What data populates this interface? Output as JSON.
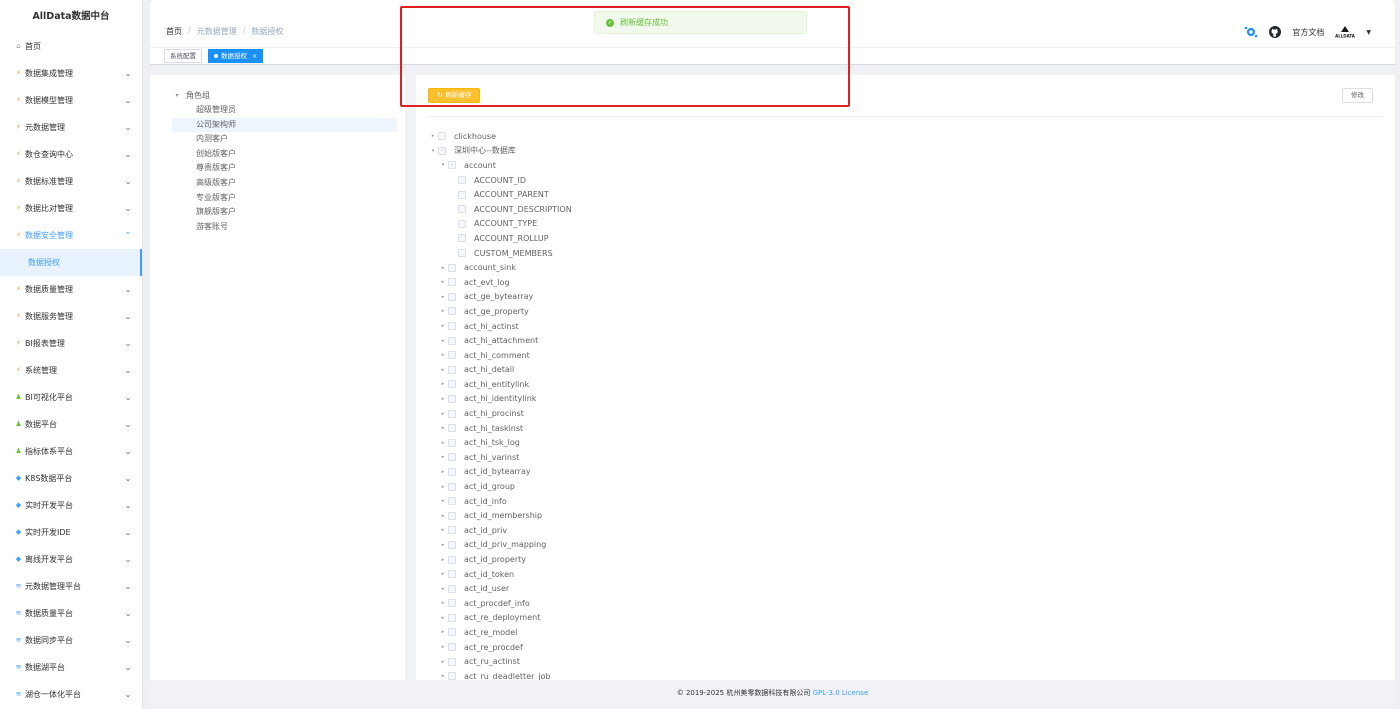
{
  "app": {
    "title": "AllData数据中台"
  },
  "sidebar": {
    "items": [
      {
        "label": "首页",
        "icon": "home-icon",
        "arrow": false
      },
      {
        "label": "数据集成管理",
        "icon": "lightning-icon",
        "arrow": true
      },
      {
        "label": "数据模型管理",
        "icon": "lightning-icon",
        "arrow": true
      },
      {
        "label": "元数据管理",
        "icon": "lightning-icon",
        "arrow": true
      },
      {
        "label": "数仓查询中心",
        "icon": "lightning-icon",
        "arrow": true
      },
      {
        "label": "数据标准管理",
        "icon": "lightning-icon",
        "arrow": true
      },
      {
        "label": "数据比对管理",
        "icon": "lightning-icon",
        "arrow": true
      },
      {
        "label": "数据安全管理",
        "icon": "lightning-icon",
        "arrow": true,
        "active": true
      },
      {
        "label": "数据质量管理",
        "icon": "lightning-icon",
        "arrow": true
      },
      {
        "label": "数据服务管理",
        "icon": "lightning-icon",
        "arrow": true
      },
      {
        "label": "BI报表管理",
        "icon": "lightning-icon",
        "arrow": true
      },
      {
        "label": "系统管理",
        "icon": "lightning-icon",
        "arrow": true
      },
      {
        "label": "BI可视化平台",
        "icon": "person-icon",
        "arrow": true
      },
      {
        "label": "数据平台",
        "icon": "person-icon",
        "arrow": true
      },
      {
        "label": "指标体系平台",
        "icon": "person-icon",
        "arrow": true
      },
      {
        "label": "K8S数据平台",
        "icon": "diamond-icon",
        "arrow": true
      },
      {
        "label": "实时开发平台",
        "icon": "diamond-icon",
        "arrow": true
      },
      {
        "label": "实时开发IDE",
        "icon": "diamond-icon",
        "arrow": true
      },
      {
        "label": "离线开发平台",
        "icon": "diamond-icon",
        "arrow": true
      },
      {
        "label": "元数据管理平台",
        "icon": "layers-icon",
        "arrow": true
      },
      {
        "label": "数据质量平台",
        "icon": "layers-icon",
        "arrow": true
      },
      {
        "label": "数据同步平台",
        "icon": "layers-icon",
        "arrow": true
      },
      {
        "label": "数据湖平台",
        "icon": "layers-icon",
        "arrow": true
      },
      {
        "label": "湖仓一体化平台",
        "icon": "layers-icon",
        "arrow": true
      }
    ],
    "active_sub": "数据授权"
  },
  "header": {
    "breadcrumb": [
      "首页",
      "元数据管理",
      "数据授权"
    ],
    "docs_label": "官方文档",
    "brand_label": "ALLDATA"
  },
  "tags": [
    {
      "label": "系统配置",
      "active": false
    },
    {
      "label": "数据授权",
      "active": true
    }
  ],
  "toast": {
    "message": "刷新缓存成功"
  },
  "left_tree": {
    "root": "角色组",
    "children": [
      "超级管理员",
      "公司架构师",
      "内测客户",
      "创始版客户",
      "尊贵版客户",
      "高级版客户",
      "专业版客户",
      "旗舰版客户",
      "游客账号"
    ],
    "selected_index": 1
  },
  "toolbar": {
    "refresh_label": "刷新缓存",
    "edit_label": "修改"
  },
  "right_tree": [
    {
      "label": "clickhouse",
      "level": 0,
      "caret": "▸"
    },
    {
      "label": "深圳中心--数据库",
      "level": 0,
      "caret": "▾",
      "partial": true
    },
    {
      "label": "account",
      "level": 1,
      "caret": "▾",
      "partial": true
    },
    {
      "label": "ACCOUNT_ID",
      "level": 2,
      "caret": ""
    },
    {
      "label": "ACCOUNT_PARENT",
      "level": 2,
      "caret": ""
    },
    {
      "label": "ACCOUNT_DESCRIPTION",
      "level": 2,
      "caret": ""
    },
    {
      "label": "ACCOUNT_TYPE",
      "level": 2,
      "caret": ""
    },
    {
      "label": "ACCOUNT_ROLLUP",
      "level": 2,
      "caret": ""
    },
    {
      "label": "CUSTOM_MEMBERS",
      "level": 2,
      "caret": ""
    },
    {
      "label": "account_sink",
      "level": 1,
      "caret": "▸"
    },
    {
      "label": "act_evt_log",
      "level": 1,
      "caret": "▸"
    },
    {
      "label": "act_ge_bytearray",
      "level": 1,
      "caret": "▸"
    },
    {
      "label": "act_ge_property",
      "level": 1,
      "caret": "▸"
    },
    {
      "label": "act_hi_actinst",
      "level": 1,
      "caret": "▸"
    },
    {
      "label": "act_hi_attachment",
      "level": 1,
      "caret": "▸"
    },
    {
      "label": "act_hi_comment",
      "level": 1,
      "caret": "▸"
    },
    {
      "label": "act_hi_detail",
      "level": 1,
      "caret": "▸"
    },
    {
      "label": "act_hi_entitylink",
      "level": 1,
      "caret": "▸"
    },
    {
      "label": "act_hi_identitylink",
      "level": 1,
      "caret": "▸"
    },
    {
      "label": "act_hi_procinst",
      "level": 1,
      "caret": "▸"
    },
    {
      "label": "act_hi_taskinst",
      "level": 1,
      "caret": "▸"
    },
    {
      "label": "act_hi_tsk_log",
      "level": 1,
      "caret": "▸"
    },
    {
      "label": "act_hi_varinst",
      "level": 1,
      "caret": "▸"
    },
    {
      "label": "act_id_bytearray",
      "level": 1,
      "caret": "▸"
    },
    {
      "label": "act_id_group",
      "level": 1,
      "caret": "▸"
    },
    {
      "label": "act_id_info",
      "level": 1,
      "caret": "▸"
    },
    {
      "label": "act_id_membership",
      "level": 1,
      "caret": "▸"
    },
    {
      "label": "act_id_priv",
      "level": 1,
      "caret": "▸"
    },
    {
      "label": "act_id_priv_mapping",
      "level": 1,
      "caret": "▸"
    },
    {
      "label": "act_id_property",
      "level": 1,
      "caret": "▸"
    },
    {
      "label": "act_id_token",
      "level": 1,
      "caret": "▸"
    },
    {
      "label": "act_id_user",
      "level": 1,
      "caret": "▸"
    },
    {
      "label": "act_procdef_info",
      "level": 1,
      "caret": "▸"
    },
    {
      "label": "act_re_deployment",
      "level": 1,
      "caret": "▸"
    },
    {
      "label": "act_re_model",
      "level": 1,
      "caret": "▸"
    },
    {
      "label": "act_re_procdef",
      "level": 1,
      "caret": "▸"
    },
    {
      "label": "act_ru_actinst",
      "level": 1,
      "caret": "▸"
    },
    {
      "label": "act_ru_deadletter_job",
      "level": 1,
      "caret": "▸"
    }
  ],
  "footer": {
    "copyright": "© 2019-2025 杭州美零数据科技有限公司",
    "license": "GPL-3.0 License"
  },
  "colors": {
    "primary": "#409eff",
    "warning": "#fbc02d",
    "success": "#67c23a",
    "highlight": "#e02020"
  }
}
